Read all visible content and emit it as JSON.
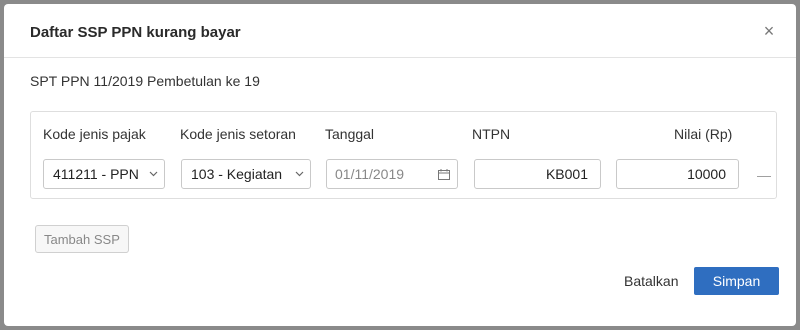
{
  "modal": {
    "title": "Daftar SSP PPN kurang bayar",
    "close_glyph": "×",
    "subtitle": "SPT PPN 11/2019 Pembetulan ke 19"
  },
  "table": {
    "headers": {
      "kode_jenis_pajak": "Kode jenis pajak",
      "kode_jenis_setoran": "Kode jenis setoran",
      "tanggal": "Tanggal",
      "ntpn": "NTPN",
      "nilai": "Nilai (Rp)"
    },
    "rows": [
      {
        "kode_jenis_pajak": "411211 - PPN",
        "kode_jenis_setoran": "103 - Kegiatan",
        "tanggal": "01/11/2019",
        "ntpn": "KB001",
        "nilai": "10000",
        "remove_glyph": "—"
      }
    ]
  },
  "actions": {
    "add_label": "Tambah SSP",
    "cancel_label": "Batalkan",
    "save_label": "Simpan"
  },
  "icons": {
    "close": "close-icon",
    "chevron": "chevron-down-icon",
    "calendar": "calendar-icon"
  },
  "colors": {
    "primary": "#2f6ec0",
    "backdrop": "#8a8a8a"
  }
}
